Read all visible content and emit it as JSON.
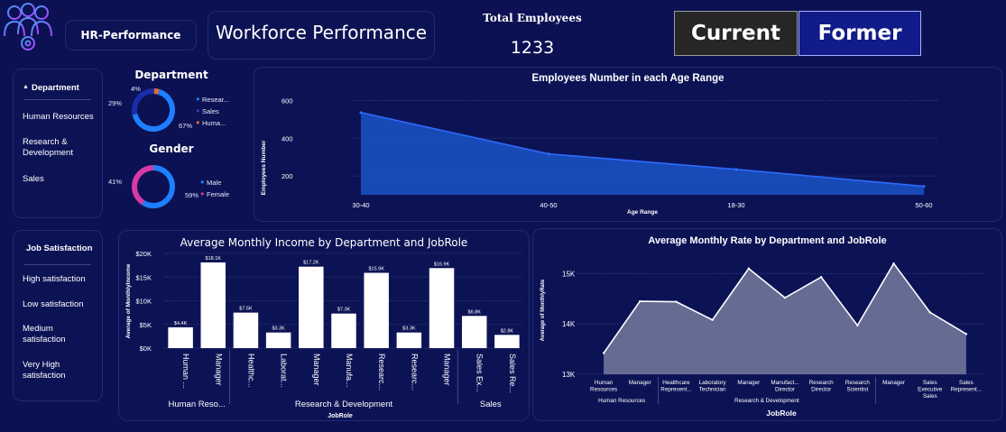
{
  "header": {
    "app_label": "HR-Performance",
    "title": "Workforce Performance",
    "kpi_label": "Total Employees",
    "kpi_value": "1233",
    "current_button": "Current",
    "former_button": "Former"
  },
  "slicers": {
    "department": {
      "label": "Department",
      "items": [
        "Human Resources",
        "Research &\nDevelopment",
        "Sales"
      ]
    },
    "job_satisfaction": {
      "label": "Job Satisfaction",
      "items": [
        "High satisfaction",
        "Low satisfaction",
        "Medium\nsatisfaction",
        "Very High\nsatisfaction"
      ]
    }
  },
  "colors": {
    "background": "#0b1152",
    "research": "#1e7fff",
    "sales": "#1a2ca8",
    "human": "#e86a2e",
    "male": "#1e7fff",
    "female": "#d53aa6",
    "area_blue": "#1a4fbf",
    "area_grey": "#6b7097",
    "bar": "#ffffff"
  },
  "chart_data": [
    {
      "type": "pie",
      "title": "Department",
      "labels": [
        "Resear...",
        "Sales",
        "Huma..."
      ],
      "values": [
        67,
        29,
        4
      ],
      "value_labels": [
        "67%",
        "29%",
        "4%"
      ]
    },
    {
      "type": "pie",
      "title": "Gender",
      "labels": [
        "Male",
        "Female"
      ],
      "values": [
        59,
        41
      ],
      "value_labels": [
        "59%",
        "41%"
      ]
    },
    {
      "type": "area",
      "title": "Employees Number in each Age Range",
      "xlabel": "Age Range",
      "ylabel": "Employees Number",
      "categories": [
        "30-40",
        "40-50",
        "18-30",
        "50-60"
      ],
      "values": [
        536,
        317,
        235,
        145
      ],
      "yticks": [
        "200",
        "400",
        "600"
      ],
      "ylim": [
        100,
        650
      ]
    },
    {
      "type": "bar",
      "title": "Average Monthly Income by Department and JobRole",
      "xlabel": "JobRole",
      "ylabel": "Average of MonthlyIncome",
      "yticks": [
        "$0K",
        "$5K",
        "$10K",
        "$15K",
        "$20K"
      ],
      "ylim": [
        0,
        20
      ],
      "categories": [
        "Human ...",
        "Manager",
        "Healthc...",
        "Laborat...",
        "Manager",
        "Manufa...",
        "Researc...",
        "Researc...",
        "Manager",
        "Sales Ex...",
        "Sales Re..."
      ],
      "values": [
        4.4,
        18.1,
        7.5,
        3.3,
        17.2,
        7.3,
        15.9,
        3.3,
        16.9,
        6.8,
        2.8
      ],
      "value_labels": [
        "$4.4K",
        "$18.1K",
        "$7.5K",
        "$3.3K",
        "$17.2K",
        "$7.3K",
        "$15.9K",
        "$3.3K",
        "$16.9K",
        "$6.8K",
        "$2.8K"
      ],
      "groups": [
        {
          "name": "Human Reso...",
          "count": 2
        },
        {
          "name": "Research & Development",
          "count": 7
        },
        {
          "name": "Sales",
          "count": 2
        }
      ]
    },
    {
      "type": "area",
      "title": "Average Monthly Rate by Department and JobRole",
      "xlabel": "JobRole",
      "ylabel": "Average of MonthlyRate",
      "yticks": [
        "13K",
        "14K",
        "15K"
      ],
      "ylim": [
        13,
        15.4
      ],
      "categories": [
        "Human\nResources",
        "Manager",
        "Healthcare\nRepresent...",
        "Laboratory\nTechnician",
        "Manager",
        "Manufact...\nDirector",
        "Research\nDirector",
        "Research\nScientist",
        "Manager",
        "Sales\nExecutive\nSales",
        "Sales\nRepresent..."
      ],
      "values": [
        13.42,
        14.45,
        14.44,
        14.08,
        15.1,
        14.52,
        14.93,
        13.97,
        15.2,
        14.23,
        13.8
      ],
      "groups": [
        {
          "name": "Human Resources",
          "count": 2
        },
        {
          "name": "Research & Development",
          "count": 6
        },
        {
          "name": "",
          "count": 3
        }
      ]
    }
  ]
}
